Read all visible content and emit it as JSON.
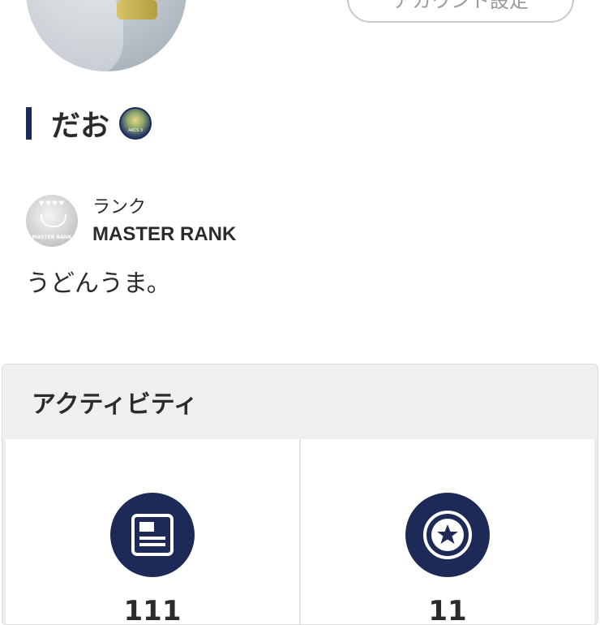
{
  "profile": {
    "account_settings_label": "アカウント設定",
    "name": "だお",
    "badge_text": "ARCS 3",
    "rank_caption": "ランク",
    "rank_value": "MASTER RANK",
    "rank_icon_text": "MASTER RANK",
    "bio": "うどんうま。"
  },
  "activity": {
    "title": "アクティビティ",
    "items": [
      {
        "icon": "article-icon",
        "count": "111"
      },
      {
        "icon": "star-circle-icon",
        "count": "11"
      }
    ]
  },
  "colors": {
    "accent": "#1d2a57",
    "header_bg": "#efefef"
  }
}
